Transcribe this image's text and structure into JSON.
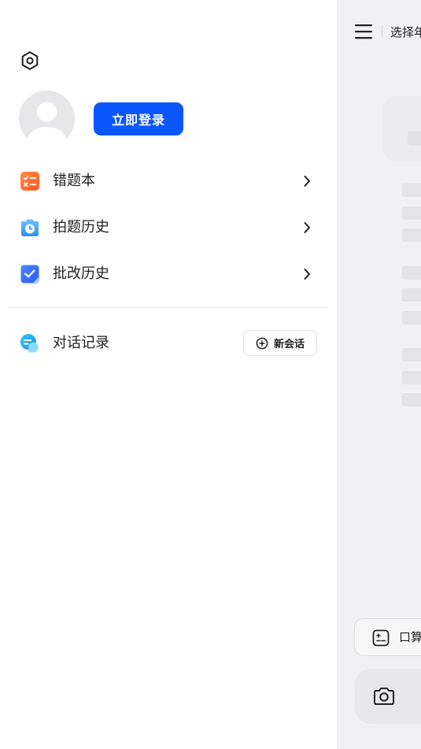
{
  "drawer": {
    "settings_icon": "settings-hexagon-icon",
    "avatar_icon": "default-avatar-icon",
    "login_label": "立即登录",
    "menu": [
      {
        "label": "错题本",
        "icon": "mistake-book-icon",
        "accent": "#ff6a2b"
      },
      {
        "label": "拍题历史",
        "icon": "photo-history-icon",
        "accent": "#3aa0f5"
      },
      {
        "label": "批改历史",
        "icon": "correction-history-icon",
        "accent": "#2f6bff"
      }
    ],
    "chat": {
      "label": "对话记录",
      "icon": "chat-record-icon",
      "new_chat_label": "新会话",
      "new_chat_icon": "plus-circle-icon"
    }
  },
  "main": {
    "menu_icon": "hamburger-icon",
    "grade_select": "选择年级",
    "mental_math_label": "口算",
    "mental_math_icon": "calc-icon",
    "camera_icon": "camera-icon"
  },
  "colors": {
    "primary": "#0a57ff",
    "orange": "#ff6a2b",
    "sky": "#3aa0f5",
    "blue": "#2f6bff",
    "cyan": "#1cb6f5"
  }
}
